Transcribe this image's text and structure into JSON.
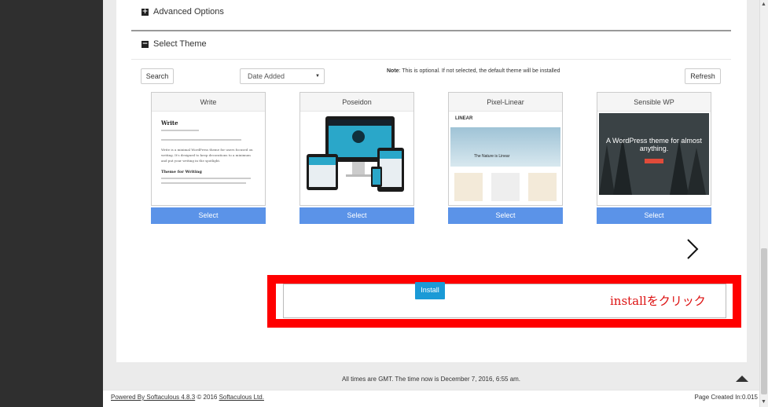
{
  "sections": {
    "advanced_options": "Advanced Options",
    "select_theme": "Select Theme"
  },
  "toolbar": {
    "search_label": "Search",
    "sort_selected": "Date Added",
    "note_bold": "Note",
    "note_text": ": This is optional. If not selected, the default theme will be installed",
    "refresh_label": "Refresh"
  },
  "themes": [
    {
      "name": "Write",
      "select_label": "Select"
    },
    {
      "name": "Poseidon",
      "select_label": "Select"
    },
    {
      "name": "Pixel-Linear",
      "select_label": "Select"
    },
    {
      "name": "Sensible WP",
      "select_label": "Select"
    }
  ],
  "previews": {
    "write_title": "Write",
    "write_text": "Write is a minimal WordPress theme for users focused on writing. It's designed to keep decorations to a minimum and put your writing in the spotlight.",
    "write_post": "Theme for Writing",
    "pixel_logo": "LINEAR",
    "pixel_hero": "The Nature is Linear",
    "sensible_text": "A WordPress theme for almost anything."
  },
  "install": {
    "button_label": "Install",
    "annotation": "installをクリック",
    "highlight_color": "#ff0000"
  },
  "footer": {
    "time_notice": "All times are GMT. The time now is December 7, 2016, 6:55 am.",
    "powered_prefix": "Powered By Softaculous 4.8.3",
    "copyright": "© 2016",
    "company": "Softaculous Ltd.",
    "page_created": "Page Created In:0.015"
  }
}
